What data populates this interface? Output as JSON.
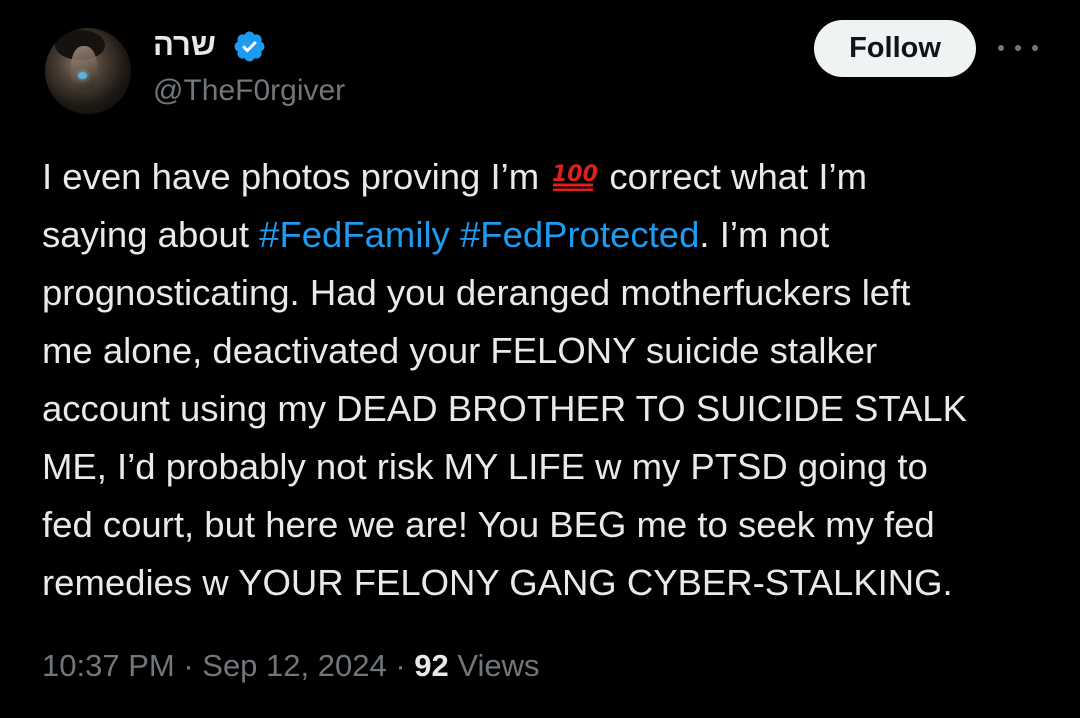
{
  "author": {
    "display_name": "שרה",
    "handle": "@TheF0rgiver",
    "verified_icon": "verified-badge-icon",
    "avatar_icon": "avatar"
  },
  "actions": {
    "follow_label": "Follow",
    "more_icon": "more-horizontal-icon"
  },
  "tweet": {
    "lines": [
      {
        "before": "I even have photos proving I’m ",
        "emoji": "💯",
        "after": " correct what I’m"
      },
      {
        "before": "saying about ",
        "tag1": "#FedFamily",
        "mid": " ",
        "tag2": "#FedProtected",
        "after": ". I’m not"
      },
      {
        "text": "prognosticating. Had you deranged motherfuckers left"
      },
      {
        "text": "me alone, deactivated your FELONY suicide stalker"
      },
      {
        "text": "account using my DEAD BROTHER TO SUICIDE STALK"
      },
      {
        "text": "ME, I’d probably not risk MY LIFE w my PTSD going to"
      },
      {
        "text": "fed court, but here we are! You BEG me to seek my fed"
      },
      {
        "text": "remedies w YOUR FELONY GANG CYBER-STALKING."
      }
    ]
  },
  "meta": {
    "time": "10:37 PM",
    "sep1": " · ",
    "date": "Sep 12, 2024",
    "sep2": " · ",
    "views_count": "92",
    "views_label": " Views"
  },
  "colors": {
    "background": "#000000",
    "text": "#e7e9ea",
    "secondary": "#71767b",
    "link": "#1d9bf0",
    "verified": "#1d9bf0",
    "follow_bg": "#eff3f4",
    "emoji_red": "#e0201b"
  }
}
